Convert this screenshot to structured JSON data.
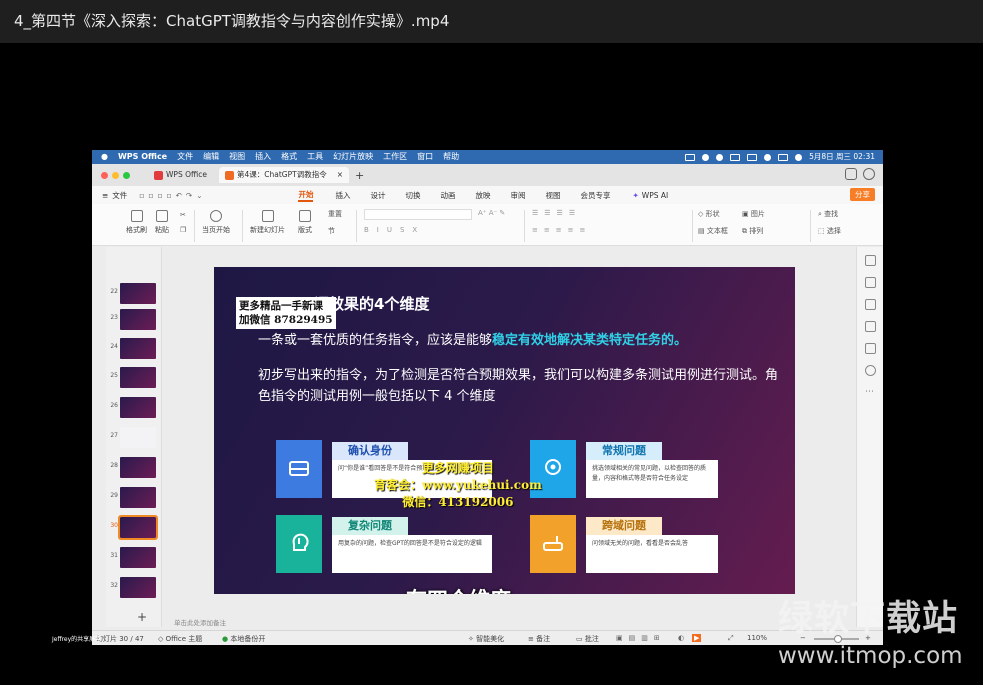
{
  "player": {
    "title": "4_第四节《深入探索：ChatGPT调教指令与内容创作实操》.mp4"
  },
  "macos_menubar": {
    "app": "WPS Office",
    "items": [
      "文件",
      "编辑",
      "视图",
      "插入",
      "格式",
      "工具",
      "幻灯片放映",
      "工作区",
      "窗口",
      "帮助"
    ],
    "clock": "5月8日 周三  02:31"
  },
  "tabs": {
    "home": "WPS Office",
    "document": "第4课：ChatGPT调教指令"
  },
  "ribbon": {
    "file_menu": "文件",
    "items": [
      "开始",
      "插入",
      "设计",
      "切换",
      "动画",
      "放映",
      "审阅",
      "视图",
      "会员专享"
    ],
    "active": "开始",
    "ai": "WPS AI",
    "share": "分享"
  },
  "toolbar": {
    "format_painter": "格式刷",
    "paste": "粘贴",
    "start_from_current": "当页开始",
    "new_slide": "新建幻灯片",
    "layout": "版式",
    "reset": "重置",
    "section": "节",
    "shape": "形状",
    "picture": "图片",
    "textbox": "文本框",
    "arrange": "排列",
    "find": "查找",
    "select": "选择"
  },
  "thumbnails": {
    "numbers": [
      "22",
      "23",
      "24",
      "25",
      "26",
      "27",
      "28",
      "29",
      "30",
      "31",
      "32"
    ],
    "selected": "30"
  },
  "slide": {
    "title": "词效果的4个维度",
    "paragraph1_plain": "一条或一套优质的任务指令，应该是能够",
    "paragraph1_highlight": "稳定有效地解决某类特定任务的。",
    "paragraph2": "初步写出来的指令，为了检测是否符合预期效果，我们可以构建多条测试用例进行测试。角色指令的测试用例一般包括以下 4 个维度",
    "cards": [
      {
        "title": "确认身份",
        "body": "问“你是谁”看回答是不是符合预期相关"
      },
      {
        "title": "常规问题",
        "body": "挑选领域相关的常见问题，以检查回答的质量，内容和格式等是否符合任务设定"
      },
      {
        "title": "复杂问题",
        "body": "用复杂的问题，检查GPT的回答是不是符合设定的逻辑"
      },
      {
        "title": "跨域问题",
        "body": "问领域无关的问题，看看是否会乱答"
      }
    ],
    "card_colors": [
      "#3d7be0",
      "#1fa6e8",
      "#19b39b",
      "#f2a12a"
    ]
  },
  "overlay": {
    "promo_line1": "更多精品一手新课",
    "promo_line2": "加微信 87829495",
    "center_line1": "更多网赚项目",
    "center_line2": "育客会：www.yukehui.com",
    "center_line3": "微信：413192006",
    "subtitle": "有四个维度"
  },
  "notes_placeholder": "单击此处添加备注",
  "statusbar": {
    "slide_info": "幻灯片 30 / 47",
    "theme": "Office 主题",
    "backup": "本地备份开",
    "smart_beautify": "智能美化",
    "notes": "备注",
    "comments": "批注",
    "zoom": "110%",
    "presenter": "Jeffrey的共享屏幕"
  },
  "site_watermark": {
    "name": "绿软下载站",
    "url": "www.itmop.com"
  }
}
